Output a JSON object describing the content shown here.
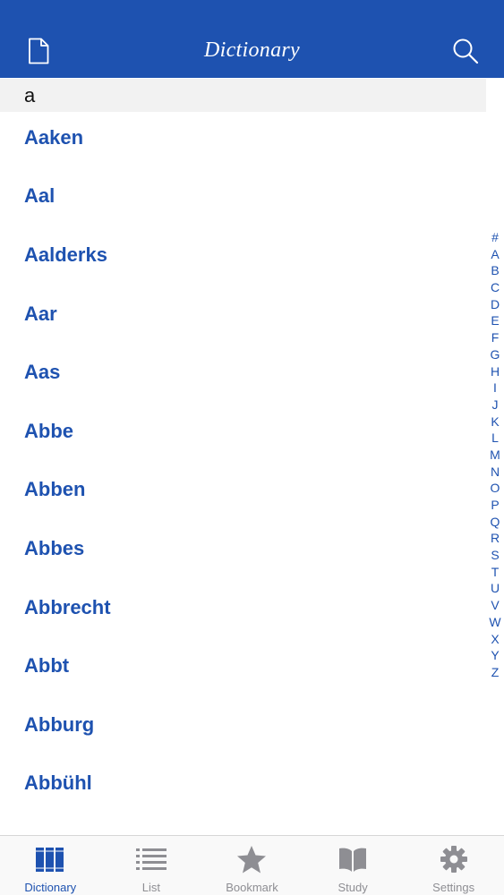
{
  "header": {
    "title": "Dictionary",
    "left_icon": "document-icon",
    "right_icon": "search-icon"
  },
  "section": {
    "title": "a"
  },
  "words": [
    "Aaken",
    "Aal",
    "Aalderks",
    "Aar",
    "Aas",
    "Abbe",
    "Abben",
    "Abbes",
    "Abbrecht",
    "Abbt",
    "Abburg",
    "Abbühl"
  ],
  "index": [
    "#",
    "A",
    "B",
    "C",
    "D",
    "E",
    "F",
    "G",
    "H",
    "I",
    "J",
    "K",
    "L",
    "M",
    "N",
    "O",
    "P",
    "Q",
    "R",
    "S",
    "T",
    "U",
    "V",
    "W",
    "X",
    "Y",
    "Z"
  ],
  "tabs": [
    {
      "label": "Dictionary",
      "icon": "books-icon",
      "active": true
    },
    {
      "label": "List",
      "icon": "list-icon",
      "active": false
    },
    {
      "label": "Bookmark",
      "icon": "star-icon",
      "active": false
    },
    {
      "label": "Study",
      "icon": "open-book-icon",
      "active": false
    },
    {
      "label": "Settings",
      "icon": "gear-icon",
      "active": false
    }
  ],
  "colors": {
    "accent": "#1e52b0",
    "inactive": "#8e8e93",
    "section_bg": "#f2f2f2"
  }
}
